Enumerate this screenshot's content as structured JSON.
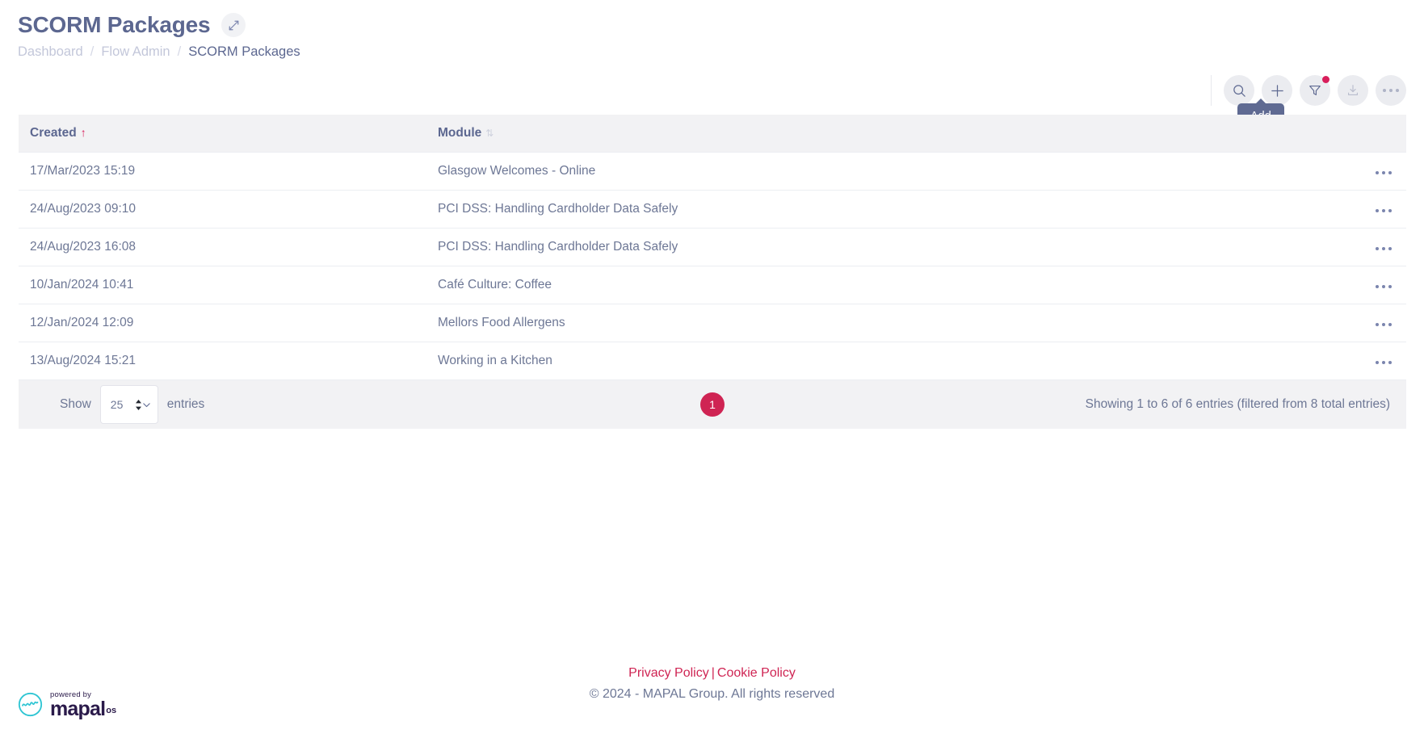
{
  "header": {
    "title": "SCORM Packages",
    "expand_icon": "expand-arrows-icon",
    "breadcrumb": [
      {
        "label": "Dashboard",
        "current": false
      },
      {
        "label": "Flow Admin",
        "current": false
      },
      {
        "label": "SCORM Packages",
        "current": true
      }
    ],
    "separator": "/"
  },
  "toolbar": {
    "search_icon": "search-icon",
    "add_icon": "plus-icon",
    "filter_icon": "filter-funnel-icon",
    "filter_badge": true,
    "download_icon": "download-icon",
    "download_disabled": true,
    "more_icon": "ellipsis-horizontal-icon",
    "tooltip": "Add"
  },
  "table": {
    "columns": [
      {
        "key": "created",
        "label": "Created",
        "sort": "asc",
        "sort_glyph": "↑"
      },
      {
        "key": "module",
        "label": "Module",
        "sort": "none",
        "sort_glyph": "⇅"
      },
      {
        "key": "actions",
        "label": "",
        "sort": "none"
      }
    ],
    "rows": [
      {
        "created": "17/Mar/2023 15:19",
        "module": "Glasgow Welcomes - Online"
      },
      {
        "created": "24/Aug/2023 09:10",
        "module": "PCI DSS: Handling Cardholder Data Safely"
      },
      {
        "created": "24/Aug/2023 16:08",
        "module": "PCI DSS: Handling Cardholder Data Safely"
      },
      {
        "created": "10/Jan/2024 10:41",
        "module": "Café Culture: Coffee"
      },
      {
        "created": "12/Jan/2024 12:09",
        "module": "Mellors Food Allergens"
      },
      {
        "created": "13/Aug/2024 15:21",
        "module": "Working in a Kitchen"
      }
    ],
    "row_menu_icon": "ellipsis-horizontal-icon"
  },
  "table_footer": {
    "show_label": "Show",
    "entries_value": "25",
    "entries_label": "entries",
    "pages": [
      {
        "label": "1",
        "active": true
      }
    ],
    "showing_info": "Showing 1 to 6 of 6 entries (filtered from 8 total entries)"
  },
  "site_footer": {
    "privacy_policy": "Privacy Policy",
    "separator": "|",
    "cookie_policy": "Cookie Policy",
    "copyright": "© 2024 - MAPAL Group. All rights reserved",
    "brand": {
      "powered_by": "powered by",
      "name": "mapal",
      "suffix": "os",
      "mark_icon": "mapal-wave-logo-icon"
    }
  },
  "colors": {
    "accent_crimson": "#cf2453",
    "slate_blue": "#5c6790",
    "text_muted": "#6d7795",
    "breadcrumb_muted": "#c3c7da",
    "header_band": "#f2f2f4",
    "tooltip_bg": "#5f6a92",
    "brand_dark": "#2a1a4a",
    "brand_cyan": "#2ec5d3"
  }
}
